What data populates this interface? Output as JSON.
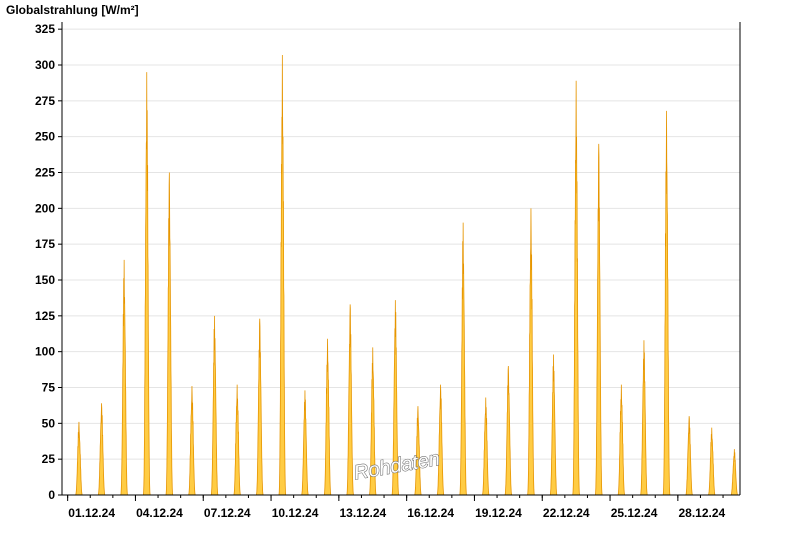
{
  "chart_data": {
    "type": "area",
    "ylabel": "Globalstrahlung [W/m²]",
    "watermark": "Rohdaten",
    "ylim": [
      0,
      330
    ],
    "yticks": [
      0,
      25,
      50,
      75,
      100,
      125,
      150,
      175,
      200,
      225,
      250,
      275,
      300,
      325
    ],
    "xlim": [
      "2024-11-30T18:00",
      "2024-12-30T18:00"
    ],
    "xticks": [
      {
        "label": "01.12.24",
        "date": "2024-12-01"
      },
      {
        "label": "04.12.24",
        "date": "2024-12-04"
      },
      {
        "label": "07.12.24",
        "date": "2024-12-07"
      },
      {
        "label": "10.12.24",
        "date": "2024-12-10"
      },
      {
        "label": "13.12.24",
        "date": "2024-12-13"
      },
      {
        "label": "16.12.24",
        "date": "2024-12-16"
      },
      {
        "label": "19.12.24",
        "date": "2024-12-19"
      },
      {
        "label": "22.12.24",
        "date": "2024-12-22"
      },
      {
        "label": "25.12.24",
        "date": "2024-12-25"
      },
      {
        "label": "28.12.24",
        "date": "2024-12-28"
      }
    ],
    "grid": true,
    "series": [
      {
        "color": "#ffcc44",
        "edge_color": "#e69500",
        "daily_peaks": [
          {
            "date": "2024-12-01",
            "max": 51
          },
          {
            "date": "2024-12-02",
            "max": 64
          },
          {
            "date": "2024-12-03",
            "max": 164
          },
          {
            "date": "2024-12-04",
            "max": 295
          },
          {
            "date": "2024-12-05",
            "max": 225
          },
          {
            "date": "2024-12-06",
            "max": 76
          },
          {
            "date": "2024-12-07",
            "max": 125
          },
          {
            "date": "2024-12-08",
            "max": 77
          },
          {
            "date": "2024-12-09",
            "max": 123
          },
          {
            "date": "2024-12-10",
            "max": 307
          },
          {
            "date": "2024-12-11",
            "max": 73
          },
          {
            "date": "2024-12-12",
            "max": 109
          },
          {
            "date": "2024-12-13",
            "max": 133
          },
          {
            "date": "2024-12-14",
            "max": 103
          },
          {
            "date": "2024-12-15",
            "max": 136
          },
          {
            "date": "2024-12-16",
            "max": 62
          },
          {
            "date": "2024-12-17",
            "max": 77
          },
          {
            "date": "2024-12-18",
            "max": 190
          },
          {
            "date": "2024-12-19",
            "max": 68
          },
          {
            "date": "2024-12-20",
            "max": 90
          },
          {
            "date": "2024-12-21",
            "max": 200
          },
          {
            "date": "2024-12-22",
            "max": 98
          },
          {
            "date": "2024-12-23",
            "max": 289
          },
          {
            "date": "2024-12-24",
            "max": 245
          },
          {
            "date": "2024-12-25",
            "max": 77
          },
          {
            "date": "2024-12-26",
            "max": 108
          },
          {
            "date": "2024-12-27",
            "max": 268
          },
          {
            "date": "2024-12-28",
            "max": 55
          },
          {
            "date": "2024-12-29",
            "max": 47
          },
          {
            "date": "2024-12-30",
            "max": 32
          }
        ]
      }
    ]
  }
}
